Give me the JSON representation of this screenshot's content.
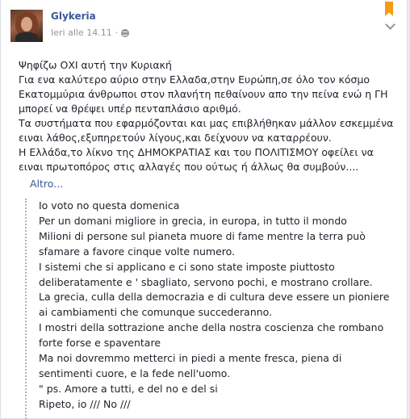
{
  "post": {
    "author": "Glykeria",
    "timestamp": "Ieri alle 14.11",
    "separator": "·",
    "greek_lines": [
      "Ψηφίζω ΟΧΙ αυτή την Κυριακή",
      "Για ενα καλύτερο αύριο στην Ελλαδα,στην Ευρώπη,σε όλο τον κόσμο",
      "Εκατομμύρια άνθρωποι στον πλανήτη πεθαίνουν απο την πείνα ενώ η ΓΗ",
      "μπορεί να θρέψει υπέρ πενταπλάσιο αριθμό.",
      "Τα συστήματα που εφαρμόζονται και μας επιβλήθηκαν μάλλον εσκεμμένα",
      "ειναι λάθος,εξυπηρετούν λίγους,και δείχνουν να καταρρέουν.",
      "Η Ελλάδα,το λίκνο της ΔΗΜΟΚΡΑΤΙΑΣ και του ΠΟΛΙΤΙΣΜΟΥ οφείλει να",
      "ειναι πρωτοπόρος στις αλλαγές που ούτως ή άλλως θα συμβούν...."
    ],
    "more_link": "Altro...",
    "italian_lines": [
      "Io voto no questa domenica",
      "Per un domani migliore in grecia, in europa, in tutto il mondo",
      "Milioni di persone sul pianeta muore di fame mentre la terra può",
      "sfamare a favore cinque volte numero.",
      "I sistemi che si applicano e ci sono state imposte piuttosto",
      "deliberatamente e ' sbagliato, servono pochi, e mostrano crollare.",
      "La grecia, culla della democrazia e di cultura deve essere un pioniere",
      "ai cambiamenti che comunque succederanno.",
      "I mostri della sottrazione anche della nostra coscienza che rombano",
      "forte forse e spaventare",
      "Ma noi dovremmo metterci in piedi a mente fresca, piena di",
      "sentimenti cuore, e la fede nell'uomo.",
      "\" ps. Amore a tutti, e del no e del si",
      "Ripeto, io /// No ///"
    ]
  },
  "icons": {
    "privacy": "globe-icon",
    "saved": "bookmark-icon",
    "options": "chevron-down-icon"
  },
  "colors": {
    "link": "#3b5998",
    "text": "#1d2129",
    "meta": "#90949c",
    "bookmark": "#f39c12"
  }
}
